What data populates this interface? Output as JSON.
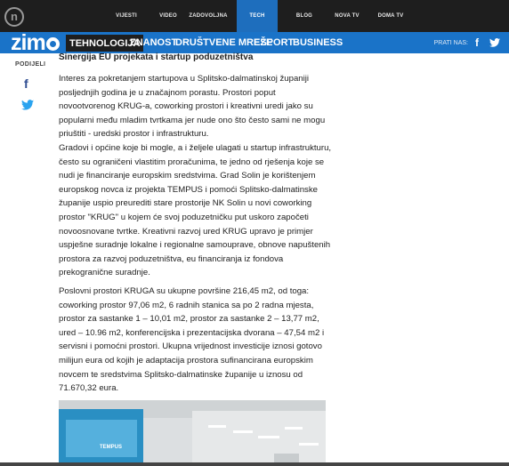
{
  "top_nav": {
    "items": [
      {
        "label": "VIJESTI",
        "active": false
      },
      {
        "label": "VIDEO",
        "active": false
      },
      {
        "label": "ZADOVOLJNA",
        "active": false
      },
      {
        "label": "TECH",
        "active": true
      },
      {
        "label": "BLOG",
        "active": false
      },
      {
        "label": "NOVA TV",
        "active": false
      },
      {
        "label": "DOMA TV",
        "active": false
      }
    ]
  },
  "brand": {
    "text": "zim"
  },
  "section_nav": {
    "items": [
      {
        "label": "TEHNOLOGIJA",
        "active": true
      },
      {
        "label": "ZNANOST",
        "active": false
      },
      {
        "label": "DRUŠTVENE MREŽE",
        "active": false
      },
      {
        "label": "ESPORT",
        "active": false
      },
      {
        "label": "BUSINESS",
        "active": false
      }
    ],
    "follow_label": "PRATI NAS:"
  },
  "share": {
    "label": "PODIJELI"
  },
  "article": {
    "subheading": "Sinergija EU projekata i startup poduzetništva",
    "paragraphs": [
      "Interes za pokretanjem startupova u Splitsko-dalmatinskoj županiji posljednjih godina je u značajnom porastu. Prostori poput novootvorenog KRUG-a, coworking prostori i kreativni uredi jako su popularni među mladim tvrtkama jer nude ono što često sami ne mogu priuštiti - uredski prostor i infrastrukturu.",
      "Gradovi i općine koje bi mogle, a i željele ulagati u startup infrastrukturu, često su ograničeni vlastitim proračunima, te jedno od rješenja koje se nudi je financiranje europskim sredstvima. Grad Solin je korištenjem europskog novca iz projekta TEMPUS i pomoći Splitsko-dalmatinske županije uspio preurediti stare prostorije NK Solin u novi coworking prostor \"KRUG\" u kojem će svoj poduzetničku put uskoro započeti novoosnovane tvrtke. Kreativni razvoj ured KRUG upravo je primjer uspješne suradnje lokalne i regionalne samouprave, obnove napuštenih prostora za razvoj poduzetništva, eu financiranja iz fondova prekogranične suradnje.",
      "Poslovni prostori KRUGA su ukupne površine 216,45 m2, od toga: coworking prostor 97,06 m2, 6 radnih stanica sa po 2 radna mjesta, prostor za sastanke 1 – 10,01 m2, prostor za sastanke 2 – 13,77 m2, ured – 10.96 m2, konferencijska i prezentacijska dvorana – 47,54 m2 i servisni i pomoćni prostori. Ukupna vrijednost investicije iznosi gotovo milijun eura od kojih je adaptacija prostora sufinancirana europskim novcem te sredstvima Splitsko-dalmatinske županije u iznosu od 71.670,32 eura."
    ],
    "photo_banner_text": "TEMPUS"
  }
}
